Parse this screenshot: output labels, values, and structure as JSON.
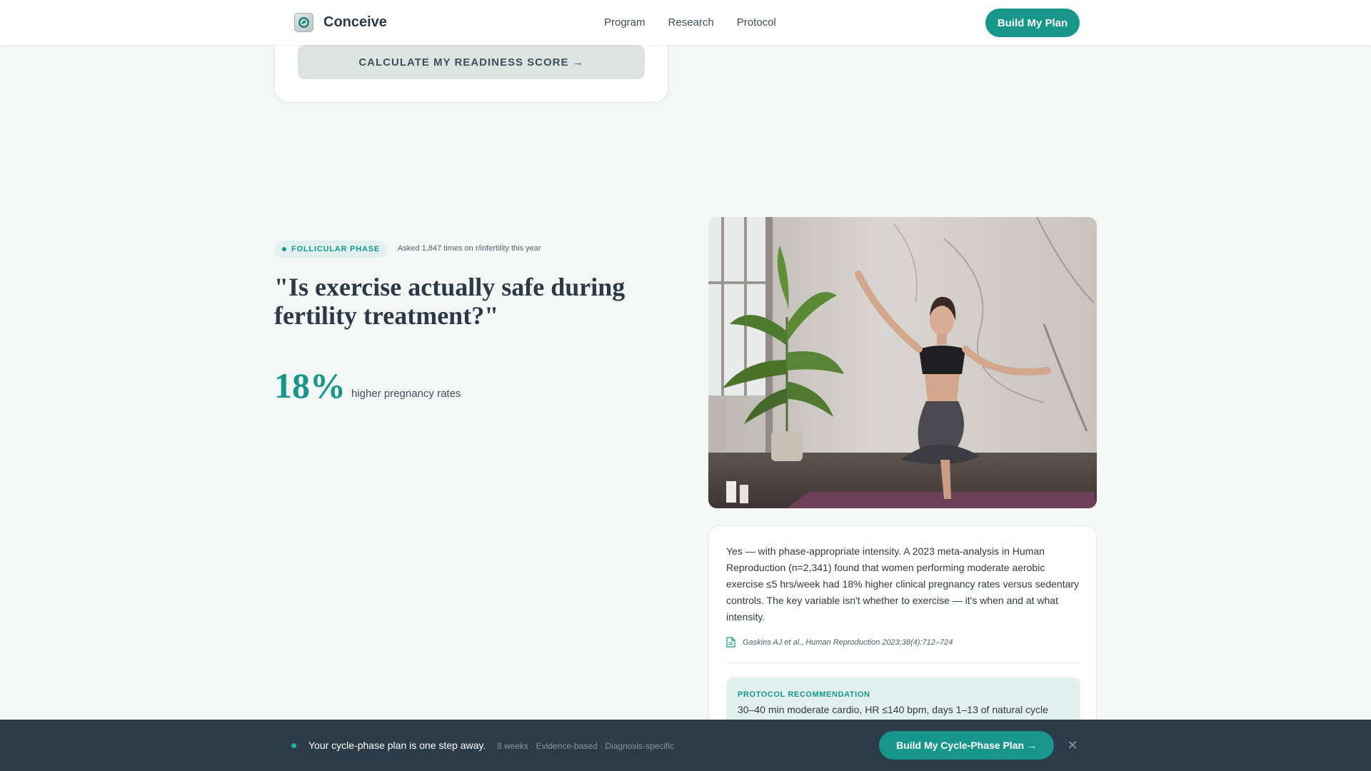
{
  "colors": {
    "accent": "#16978a",
    "background": "#f3f7f6",
    "bottom_bar": "#2b3b48",
    "heading": "#2d3a46"
  },
  "nav": {
    "brand": "Conceive",
    "logo_icon": "leaf-badge-icon",
    "links": [
      "Program",
      "Research",
      "Protocol"
    ],
    "cta": "Build My Plan"
  },
  "readiness": {
    "button_label": "CALCULATE MY READINESS SCORE →"
  },
  "question_block": {
    "phase_badge": "FOLLICULAR PHASE",
    "asked_note": "Asked 1,847 times on r/infertility this year",
    "question": "\"Is exercise actually safe during fertility treatment?\"",
    "stat_value": "18%",
    "stat_label": "higher pregnancy rates"
  },
  "answer": {
    "text": "Yes — with phase-appropriate intensity. A 2023 meta-analysis in Human Reproduction (n=2,341) found that women performing moderate aerobic exercise ≤5 hrs/week had 18% higher clinical pregnancy rates versus sedentary controls. The key variable isn't whether to exercise — it's when and at what intensity.",
    "citation_icon": "document-icon",
    "citation": "Gaskins AJ et al., Human Reproduction 2023;38(4):712–724",
    "protocol_title": "PROTOCOL RECOMMENDATION",
    "protocol_text": "30–40 min moderate cardio, HR ≤140 bpm, days 1–13 of natural cycle"
  },
  "bottom_bar": {
    "message": "Your cycle-phase plan is one step away.",
    "meta": "8 weeks · Evidence-based · Diagnosis-specific",
    "cta": "Build My Cycle-Phase Plan →",
    "close_icon": "close-icon"
  }
}
